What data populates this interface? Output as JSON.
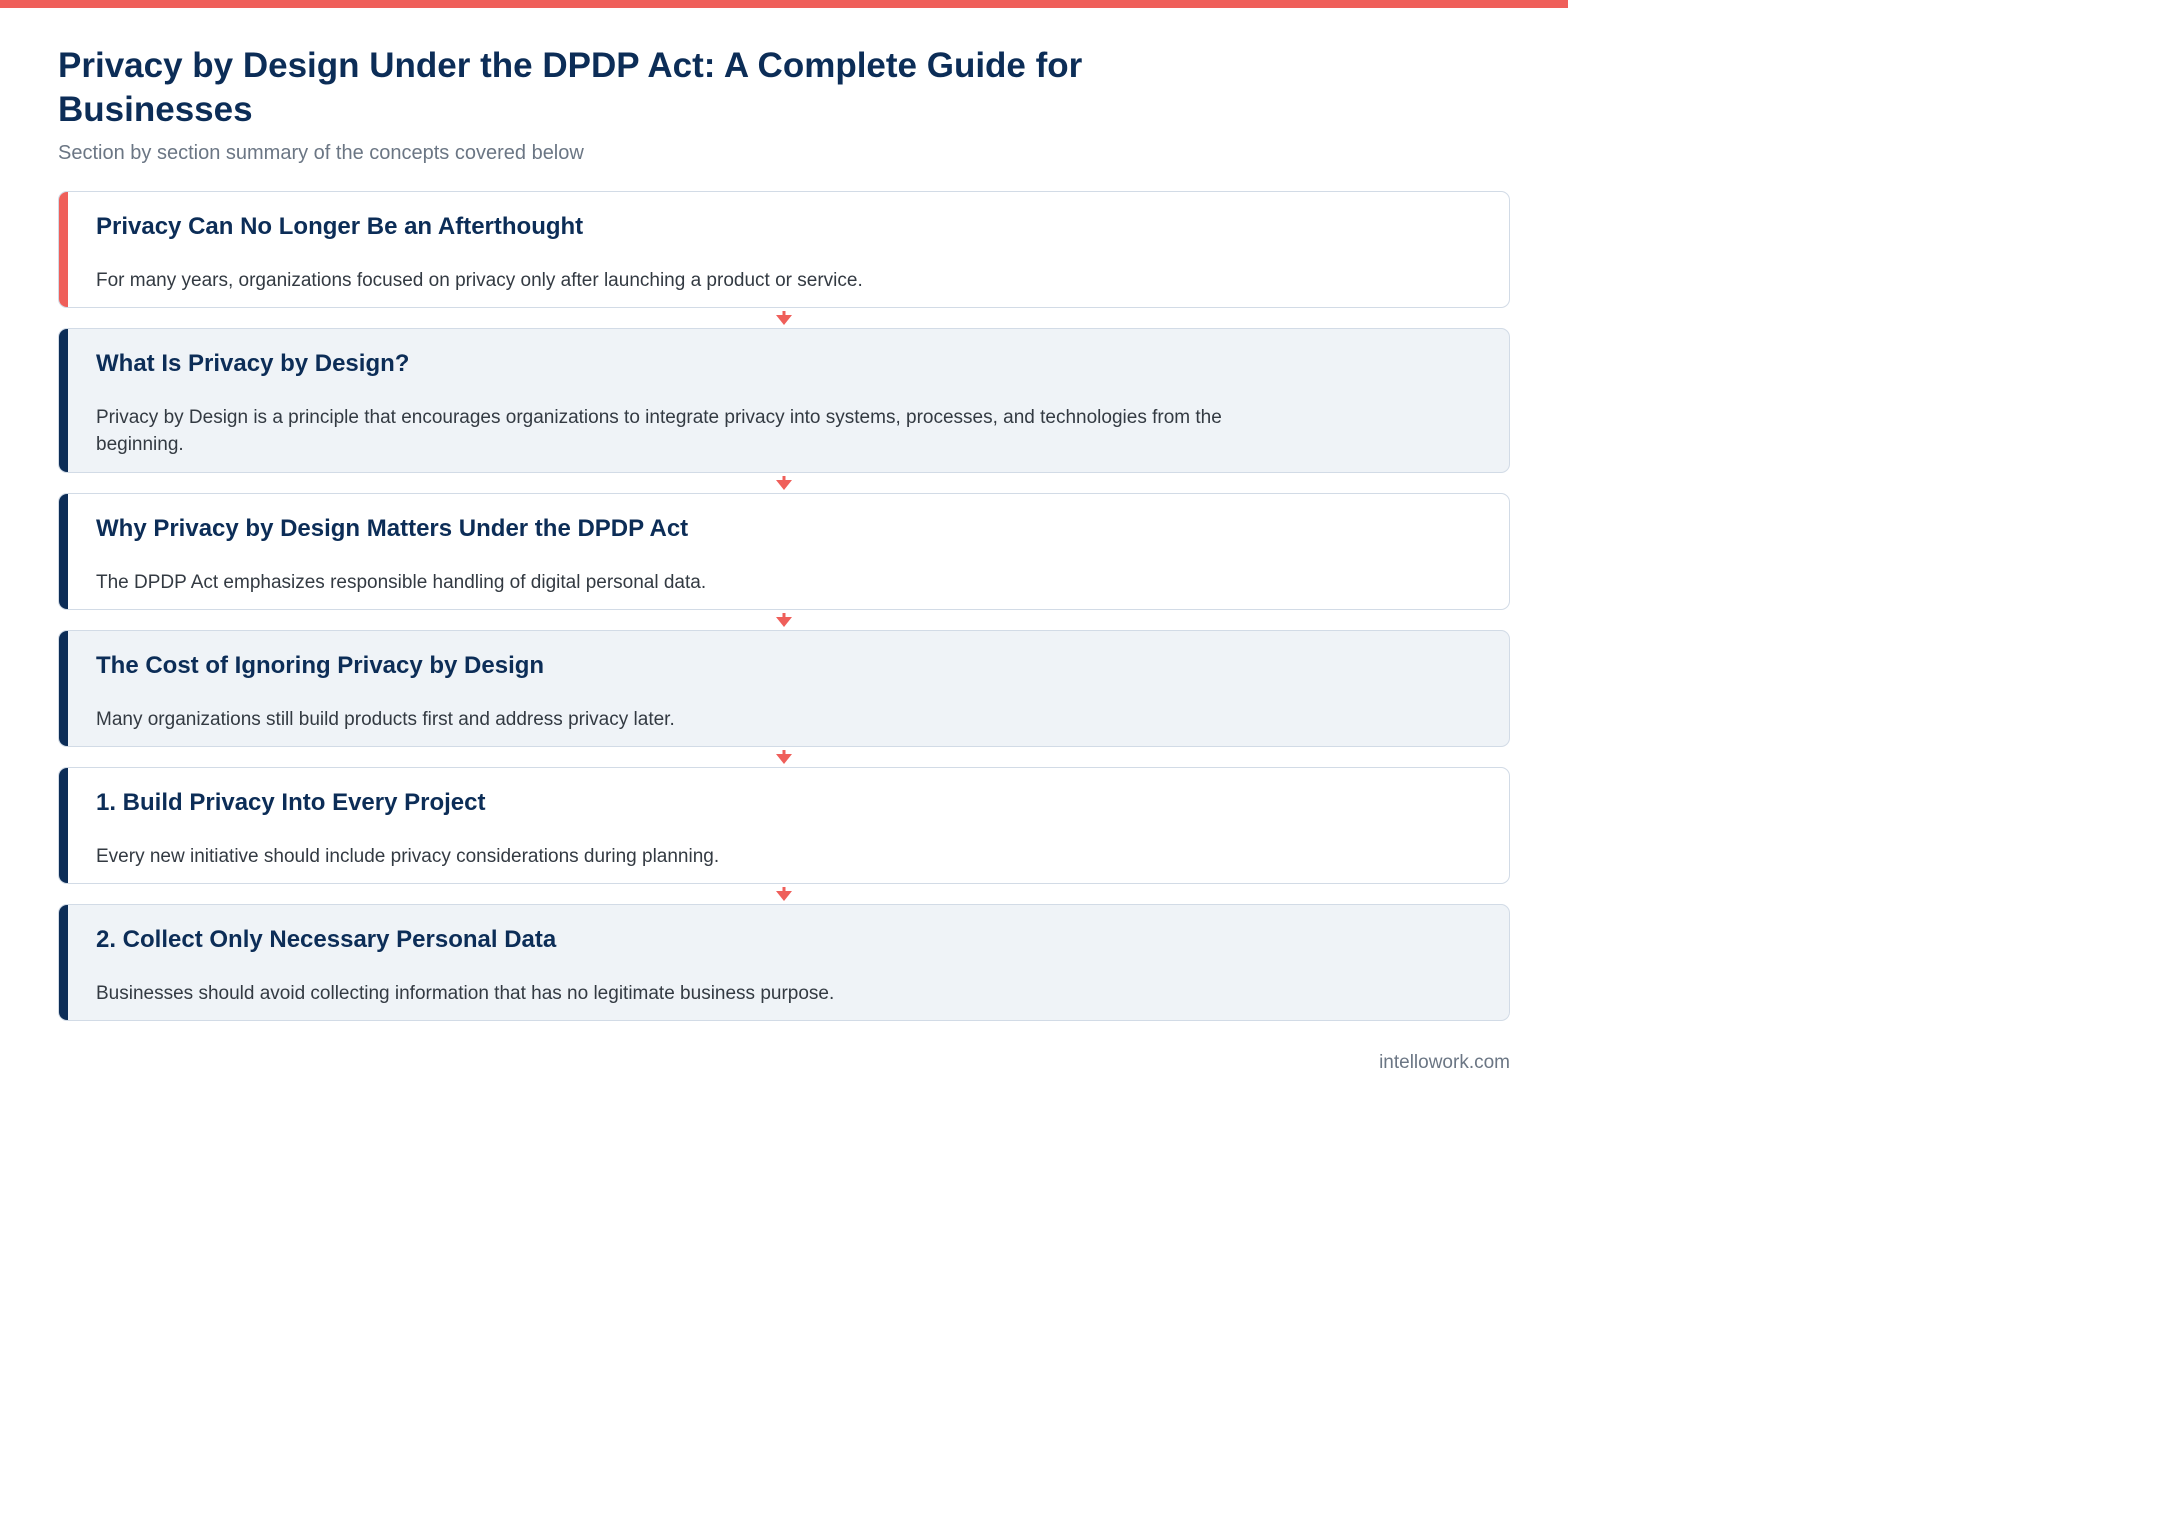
{
  "header": {
    "title": "Privacy by Design Under the DPDP Act: A Complete Guide for Businesses",
    "subtitle": "Section by section summary of the concepts covered below"
  },
  "sections": [
    {
      "title": "Privacy Can No Longer Be an Afterthought",
      "text": "For many years, organizations focused on privacy only after launching a product or service."
    },
    {
      "title": "What Is Privacy by Design?",
      "text": "Privacy by Design is a principle that encourages organizations to integrate privacy into systems, processes, and technologies from the beginning."
    },
    {
      "title": "Why Privacy by Design Matters Under the DPDP Act",
      "text": "The DPDP Act emphasizes responsible handling of digital personal data."
    },
    {
      "title": "The Cost of Ignoring Privacy by Design",
      "text": "Many organizations still build products first and address privacy later."
    },
    {
      "title": "1. Build Privacy Into Every Project",
      "text": "Every new initiative should include privacy considerations during planning."
    },
    {
      "title": "2. Collect Only Necessary Personal Data",
      "text": "Businesses should avoid collecting information that has no legitimate business purpose."
    }
  ],
  "footer": {
    "source": "intellowork.com"
  },
  "colors": {
    "accent": "#ef5f5a",
    "navy": "#0c2d57",
    "card_alt_bg": "#eff3f7"
  }
}
